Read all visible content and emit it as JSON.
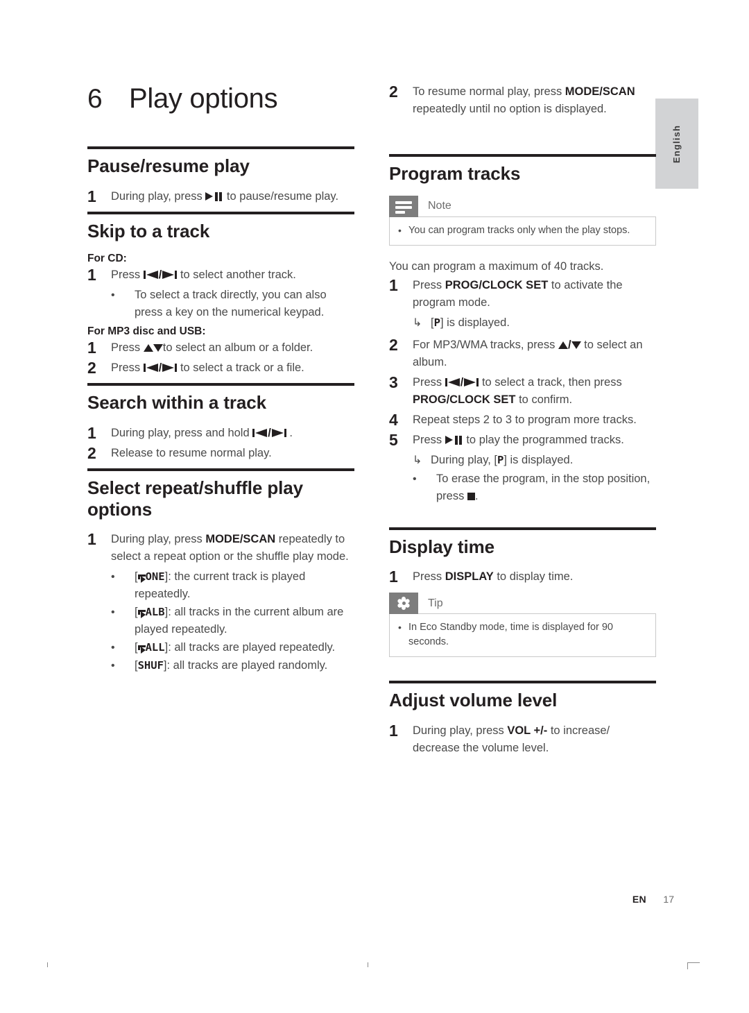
{
  "page": {
    "chapter_number": "6",
    "chapter_title": "Play options",
    "language_tab": "English",
    "footer_lang": "EN",
    "footer_page": "17"
  },
  "left_column": {
    "pause_resume": {
      "heading": "Pause/resume play",
      "step1_num": "1",
      "step1_before": "During play, press ",
      "step1_after": " to pause/resume play."
    },
    "skip_track": {
      "heading": "Skip to a track",
      "for_cd_label": "For CD:",
      "cd_step1_num": "1",
      "cd_step1_before": "Press ",
      "cd_step1_after": " to select another track.",
      "cd_bullet": "To select a track directly, you can also press a key on the numerical keypad.",
      "for_mp3_label": "For MP3 disc and USB:",
      "mp3_step1_num": "1",
      "mp3_step1_before": "Press ",
      "mp3_step1_after": "to select an album or a folder.",
      "mp3_step2_num": "2",
      "mp3_step2_before": "Press ",
      "mp3_step2_after": " to select a track or a file."
    },
    "search_track": {
      "heading": "Search within a track",
      "step1_num": "1",
      "step1_before": "During play, press and hold ",
      "step1_after": " .",
      "step2_num": "2",
      "step2_text": "Release to resume normal play."
    },
    "repeat_shuffle": {
      "heading": "Select repeat/shuffle play options",
      "step1_num": "1",
      "step1_a": "During play, press ",
      "step1_bold": "MODE/SCAN",
      "step1_b": " repeatedly to select a repeat option or the shuffle play mode.",
      "options": [
        {
          "code": "ONE",
          "repeat_icon": true,
          "desc": ": the current track is played repeatedly."
        },
        {
          "code": "ALB",
          "repeat_icon": true,
          "desc": ": all tracks in the current album are played repeatedly."
        },
        {
          "code": "ALL",
          "repeat_icon": true,
          "desc": ": all tracks are played repeatedly."
        },
        {
          "code": "SHUF",
          "repeat_icon": false,
          "desc": ": all tracks are played randomly."
        }
      ]
    }
  },
  "right_column": {
    "repeat_shuffle_cont": {
      "step2_num": "2",
      "step2_a": "To resume normal play, press ",
      "step2_bold": "MODE/SCAN",
      "step2_b": " repeatedly until no option is displayed."
    },
    "program_tracks": {
      "heading": "Program tracks",
      "note": {
        "label": "Note",
        "icon": "note-icon",
        "bullet": "You can program tracks only when the play stops."
      },
      "intro": "You can program a maximum of 40 tracks.",
      "step1_num": "1",
      "step1_a": "Press ",
      "step1_bold": "PROG/CLOCK SET",
      "step1_b": " to activate the program mode.",
      "step1_result_pre": "[",
      "step1_result_code": "P",
      "step1_result_post": "] is displayed.",
      "step2_num": "2",
      "step2_before": "For MP3/WMA tracks, press ",
      "step2_mid": "/",
      "step2_after": " to select an album.",
      "step3_num": "3",
      "step3_a": "Press ",
      "step3_b": " to select a track, then press ",
      "step3_bold": "PROG/CLOCK SET",
      "step3_c": " to confirm.",
      "step4_num": "4",
      "step4_text": "Repeat steps 2 to 3 to program more tracks.",
      "step5_num": "5",
      "step5_before": "Press ",
      "step5_after": " to play the programmed tracks.",
      "step5_result_pre": "During play, [",
      "step5_result_code": "P",
      "step5_result_post": "] is displayed.",
      "erase_bullet_before": "To erase the program, in the stop position, press ",
      "erase_bullet_after": "."
    },
    "display_time": {
      "heading": "Display time",
      "step1_num": "1",
      "step1_a": "Press ",
      "step1_bold": "DISPLAY",
      "step1_b": " to display time.",
      "tip": {
        "label": "Tip",
        "icon": "tip-icon",
        "bullet": "In Eco Standby mode, time is displayed for 90 seconds."
      }
    },
    "adjust_volume": {
      "heading": "Adjust volume level",
      "step1_num": "1",
      "step1_a": "During play, press ",
      "step1_bold": "VOL +/-",
      "step1_b": " to increase/ decrease the volume level."
    }
  },
  "colors": {
    "rule": "#231f20",
    "body_text": "#4a4a4a",
    "heading_text": "#231f20",
    "callout_icon_bg": "#7d7d7d",
    "lang_tab_bg": "#d2d3d5"
  }
}
